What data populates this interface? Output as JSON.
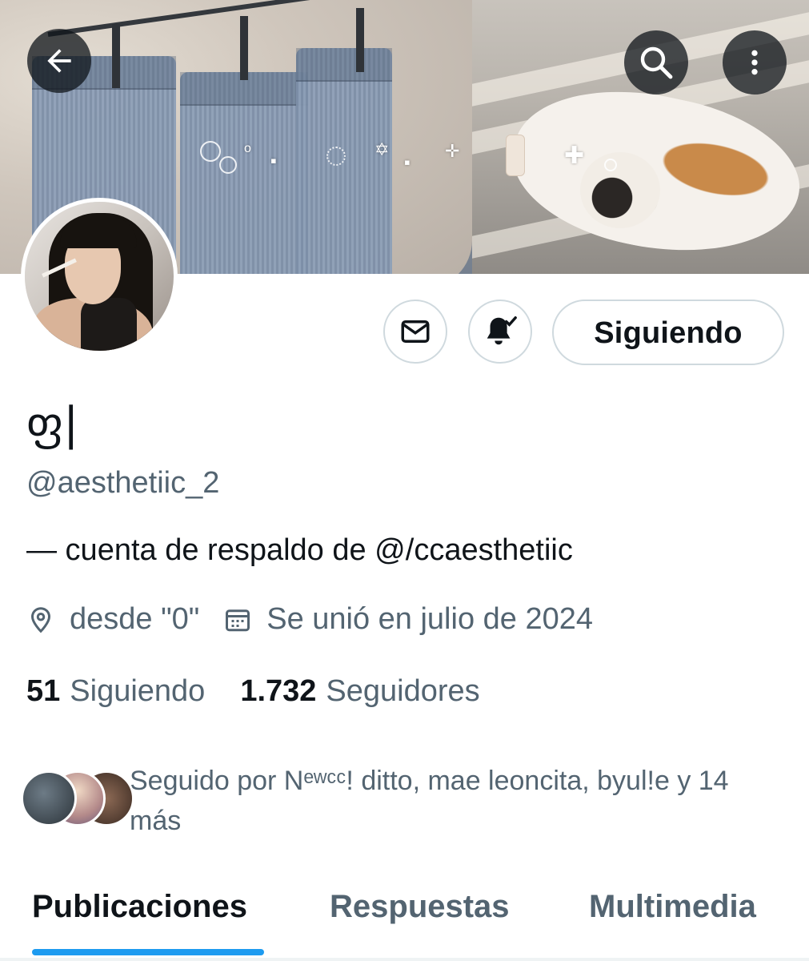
{
  "profile": {
    "display_name": "ფ|",
    "handle": "@aesthetiic_2",
    "bio": "— cuenta de respaldo de @/ccaesthetiic",
    "location": "desde \"0\"",
    "joined": "Se unió en julio de 2024",
    "following_count": "51",
    "following_label": "Siguiendo",
    "followers_count": "1.732",
    "followers_label": "Seguidores",
    "followed_by": "Seguido por Nᵉʷᶜᶜ! ditto, mae leoncita, byul!e y 14 más"
  },
  "actions": {
    "follow_button": "Siguiendo"
  },
  "icons": {
    "back": "arrow-left-icon",
    "search": "search-icon",
    "more": "more-vertical-icon",
    "message": "envelope-icon",
    "notifications": "bell-check-icon",
    "location": "location-pin-icon",
    "calendar": "calendar-icon"
  },
  "tabs": [
    {
      "label": "Publicaciones",
      "active": true
    },
    {
      "label": "Respuestas",
      "active": false
    },
    {
      "label": "Multimedia",
      "active": false
    }
  ],
  "colors": {
    "accent": "#1d9bf0",
    "text_primary": "#0f1419",
    "text_secondary": "#536471",
    "border": "#cfd9de"
  }
}
